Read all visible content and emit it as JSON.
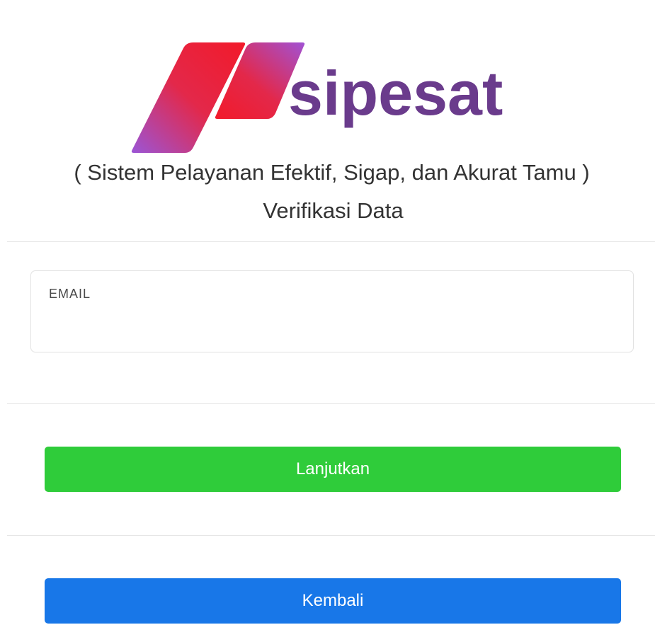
{
  "brand": {
    "name": "sipesat",
    "logo_icon": "sipesat-slash-logo-icon",
    "colors": {
      "wordmark": "#6a3b8c",
      "gradient_red": "#f21a2a",
      "gradient_purple": "#9b55d6"
    }
  },
  "header": {
    "subtitle": "( Sistem Pelayanan Efektif, Sigap, dan Akurat Tamu )",
    "title": "Verifikasi Data"
  },
  "form": {
    "email_label": "EMAIL",
    "email_value": "",
    "email_placeholder": ""
  },
  "actions": {
    "continue_label": "Lanjutkan",
    "continue_color": "#2fcc3a",
    "back_label": "Kembali",
    "back_color": "#1877e8"
  }
}
